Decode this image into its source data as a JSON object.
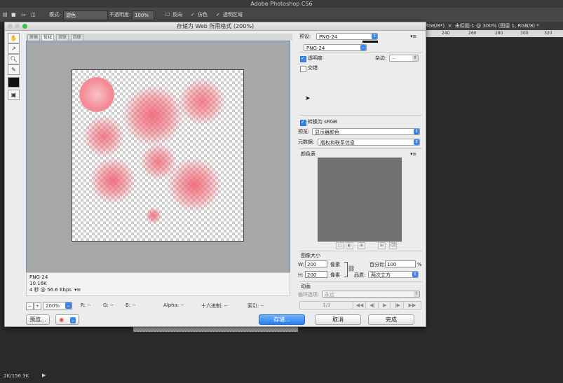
{
  "app": {
    "title": "Adobe Photoshop CS6"
  },
  "optionsbar": {
    "mode_label": "模式:",
    "mode_value": "滤色",
    "opacity_label": "不透明度:",
    "opacity_value": "100%",
    "reverse_label": "反向",
    "dither_label": "仿色",
    "transparency_label": "透明区域"
  },
  "doc_tabs": {
    "tab1": "RGB/8*)",
    "tab2": "未标题-1 @ 300% (图层 1, RGB/8) *"
  },
  "ruler": {
    "ticks": [
      "240",
      "260",
      "280",
      "300",
      "320"
    ]
  },
  "status": {
    "doc_size": ".2K/156.3K"
  },
  "dialog": {
    "title": "存储为 Web 所用格式 (200%)",
    "view_tabs": [
      "原稿",
      "优化",
      "双联",
      "四联"
    ],
    "info": {
      "format": "PNG-24",
      "size": "10.16K",
      "time": "4 秒 @ 56.6 Kbps"
    },
    "bottombar": {
      "zoom": "200%",
      "r": "R: --",
      "g": "G: --",
      "b": "B: --",
      "alpha": "Alpha: --",
      "hex": "十六进制: --",
      "index": "索引: --"
    },
    "buttons": {
      "preview": "预览...",
      "save": "存储...",
      "cancel": "取消",
      "done": "完成"
    },
    "settings": {
      "preset_label": "预设:",
      "preset_value": "PNG-24",
      "format_value": "PNG-24",
      "transparency": "透明度",
      "matte_label": "杂边:",
      "matte_value": "--",
      "interlaced": "交错",
      "convert_srgb": "转换为 sRGB",
      "preview_label": "预览:",
      "preview_value": "显示器颜色",
      "metadata_label": "元数据:",
      "metadata_value": "版权和联系信息",
      "color_table": "颜色表",
      "image_size": "图像大小",
      "w_label": "W:",
      "w_value": "200",
      "h_label": "H:",
      "h_value": "200",
      "px": "像素",
      "percent_label": "百分比:",
      "percent_value": "100",
      "percent_unit": "%",
      "quality_label": "品质:",
      "quality_value": "两次立方",
      "animation": "动画",
      "loop_label": "循环选项:",
      "loop_value": "永远",
      "frame_counter": "1/1"
    }
  },
  "colors": {
    "accent": "#3a86e8",
    "blob": "#f26a78"
  }
}
